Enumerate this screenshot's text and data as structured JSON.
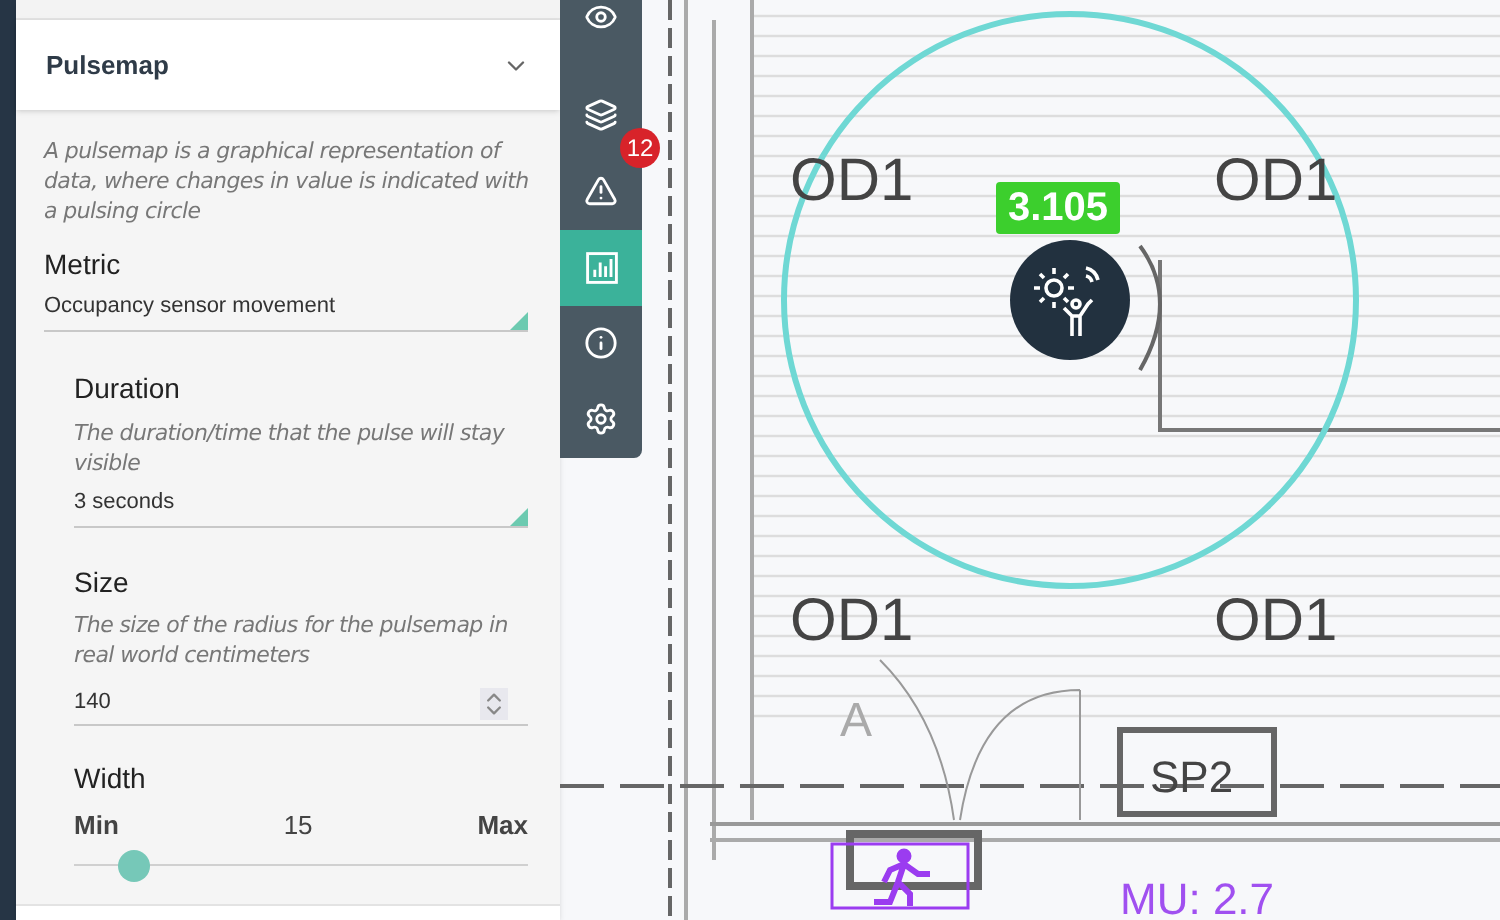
{
  "panel": {
    "title": "Pulsemap",
    "expanded": true,
    "description": "A pulsemap is a graphical representation of data, where changes in value is indicated with a pulsing circle",
    "metric": {
      "label": "Metric",
      "value": "Occupancy sensor movement"
    },
    "duration": {
      "label": "Duration",
      "description": "The duration/time that the pulse will stay visible",
      "value": "3 seconds"
    },
    "size": {
      "label": "Size",
      "description": "The size of the radius for the pulsemap in real world centimeters",
      "value": "140"
    },
    "width": {
      "label": "Width",
      "min_label": "Min",
      "value": "15",
      "max_label": "Max",
      "level": 0.13
    }
  },
  "toolbar": [
    {
      "kind": "eye",
      "selected": false
    },
    {
      "kind": "layers",
      "selected": false
    },
    {
      "kind": "alert",
      "selected": false,
      "badge": "12"
    },
    {
      "kind": "chart",
      "selected": true
    },
    {
      "kind": "info",
      "selected": false
    },
    {
      "kind": "settings",
      "selected": false
    }
  ],
  "map": {
    "room_labels": [
      "OD1",
      "OD1",
      "OD1",
      "OD1"
    ],
    "door_label": "A",
    "box_label": "SP2",
    "zone_label": "MU: 2.7",
    "sensor": {
      "value": "3.105"
    }
  }
}
